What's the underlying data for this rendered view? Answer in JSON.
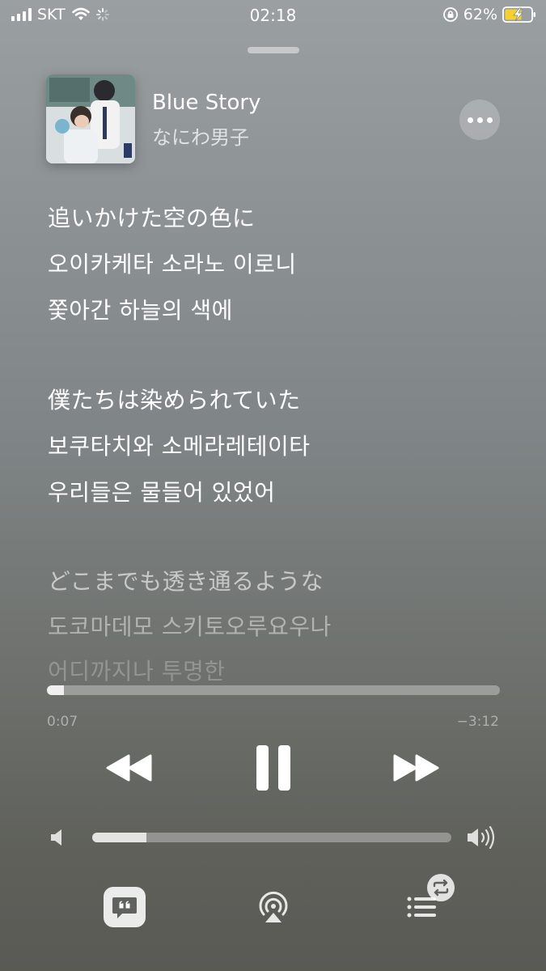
{
  "status_bar": {
    "carrier": "SKT",
    "time": "02:18",
    "battery": "62%"
  },
  "now_playing": {
    "title": "Blue Story",
    "artist": "なにわ男子",
    "more_icon": "ellipsis-icon"
  },
  "lyrics": [
    {
      "text": "追いかけた空の色に",
      "opacity": 1.0
    },
    {
      "text": "오이카케타 소라노 이로니",
      "opacity": 1.0
    },
    {
      "text": "쫓아간 하늘의 색에",
      "opacity": 1.0
    },
    {
      "text": "僕たちは染められていた",
      "opacity": 1.0
    },
    {
      "text": "보쿠타치와 소메라레테이타",
      "opacity": 1.0
    },
    {
      "text": "우리들은 물들어 있었어",
      "opacity": 1.0
    },
    {
      "text": "どこまでも透き通るような",
      "opacity": 0.6
    },
    {
      "text": "도코마데모 스키토오루요우나",
      "opacity": 0.45
    },
    {
      "text": "어디까지나 투명한",
      "opacity": 0.25
    }
  ],
  "playback": {
    "elapsed": "0:07",
    "remaining": "−3:12",
    "progress_fraction": 0.037,
    "volume_fraction": 0.15
  },
  "controls": {
    "rewind_icon": "rewind-icon",
    "pause_icon": "pause-icon",
    "forward_icon": "fast-forward-icon",
    "lyrics_icon": "lyrics-quote-icon",
    "airplay_icon": "airplay-audio-icon",
    "queue_icon": "queue-list-icon"
  }
}
